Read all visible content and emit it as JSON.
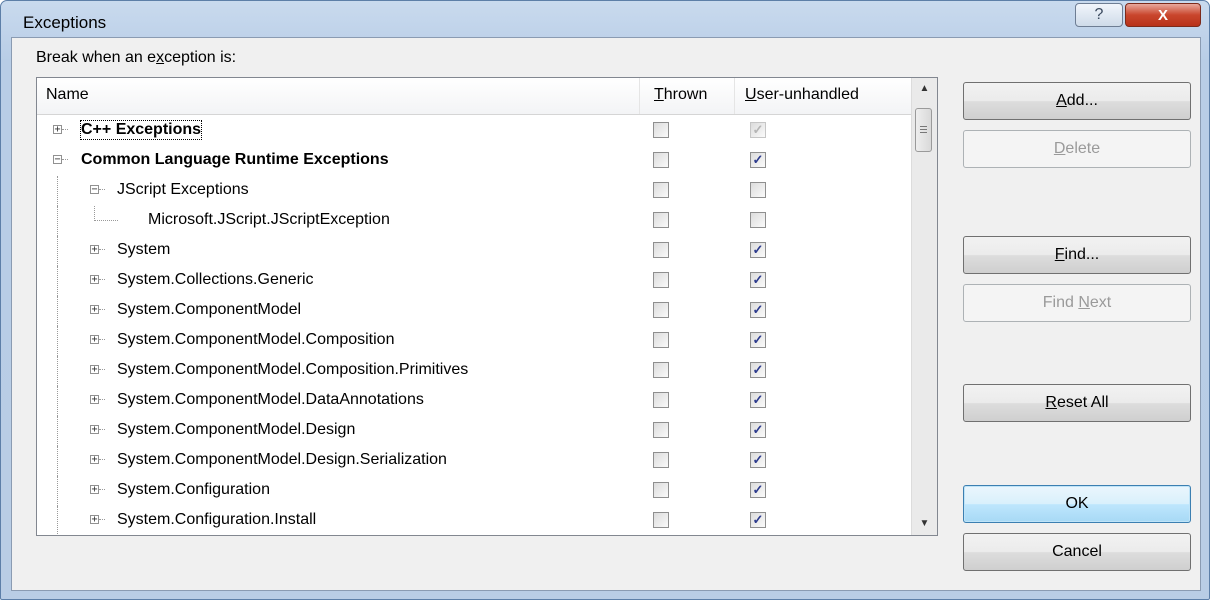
{
  "window": {
    "title": "Exceptions",
    "help_glyph": "?",
    "close_glyph": "X"
  },
  "prompt": {
    "before": "Break when an e",
    "accel": "x",
    "after": "ception is:"
  },
  "columns": {
    "name": "Name",
    "thrown": {
      "accel": "T",
      "rest": "hrown"
    },
    "user_unhandled": {
      "accel": "U",
      "rest": "ser-unhandled"
    }
  },
  "rows": [
    {
      "label": "C++ Exceptions",
      "level": 0,
      "expander": "+",
      "bold": true,
      "focused": true,
      "thrown": false,
      "user_unhandled": true,
      "user_unhandled_dim": true
    },
    {
      "label": "Common Language Runtime Exceptions",
      "level": 0,
      "expander": "−",
      "bold": true,
      "thrown": false,
      "user_unhandled": true
    },
    {
      "label": "JScript Exceptions",
      "level": 1,
      "expander": "−",
      "thrown": false,
      "user_unhandled": false
    },
    {
      "label": "Microsoft.JScript.JScriptException",
      "level": 2,
      "expander": "",
      "thrown": false,
      "user_unhandled": false
    },
    {
      "label": "System",
      "level": 1,
      "expander": "+",
      "thrown": false,
      "user_unhandled": true
    },
    {
      "label": "System.Collections.Generic",
      "level": 1,
      "expander": "+",
      "thrown": false,
      "user_unhandled": true
    },
    {
      "label": "System.ComponentModel",
      "level": 1,
      "expander": "+",
      "thrown": false,
      "user_unhandled": true
    },
    {
      "label": "System.ComponentModel.Composition",
      "level": 1,
      "expander": "+",
      "thrown": false,
      "user_unhandled": true
    },
    {
      "label": "System.ComponentModel.Composition.Primitives",
      "level": 1,
      "expander": "+",
      "thrown": false,
      "user_unhandled": true
    },
    {
      "label": "System.ComponentModel.DataAnnotations",
      "level": 1,
      "expander": "+",
      "thrown": false,
      "user_unhandled": true
    },
    {
      "label": "System.ComponentModel.Design",
      "level": 1,
      "expander": "+",
      "thrown": false,
      "user_unhandled": true
    },
    {
      "label": "System.ComponentModel.Design.Serialization",
      "level": 1,
      "expander": "+",
      "thrown": false,
      "user_unhandled": true
    },
    {
      "label": "System.Configuration",
      "level": 1,
      "expander": "+",
      "thrown": false,
      "user_unhandled": true
    },
    {
      "label": "System.Configuration.Install",
      "level": 1,
      "expander": "+",
      "thrown": false,
      "user_unhandled": true
    }
  ],
  "buttons": {
    "add": {
      "accel": "A",
      "rest": "dd..."
    },
    "delete": {
      "accel": "D",
      "rest": "elete"
    },
    "find": {
      "accel": "F",
      "rest": "ind..."
    },
    "find_next": {
      "pre": "Find ",
      "accel": "N",
      "rest": "ext"
    },
    "reset_all": {
      "accel": "R",
      "rest": "eset All"
    },
    "ok": "OK",
    "cancel": "Cancel"
  },
  "checkmark_glyph": "✓",
  "scroll": {
    "up_glyph": "▲",
    "down_glyph": "▼"
  }
}
